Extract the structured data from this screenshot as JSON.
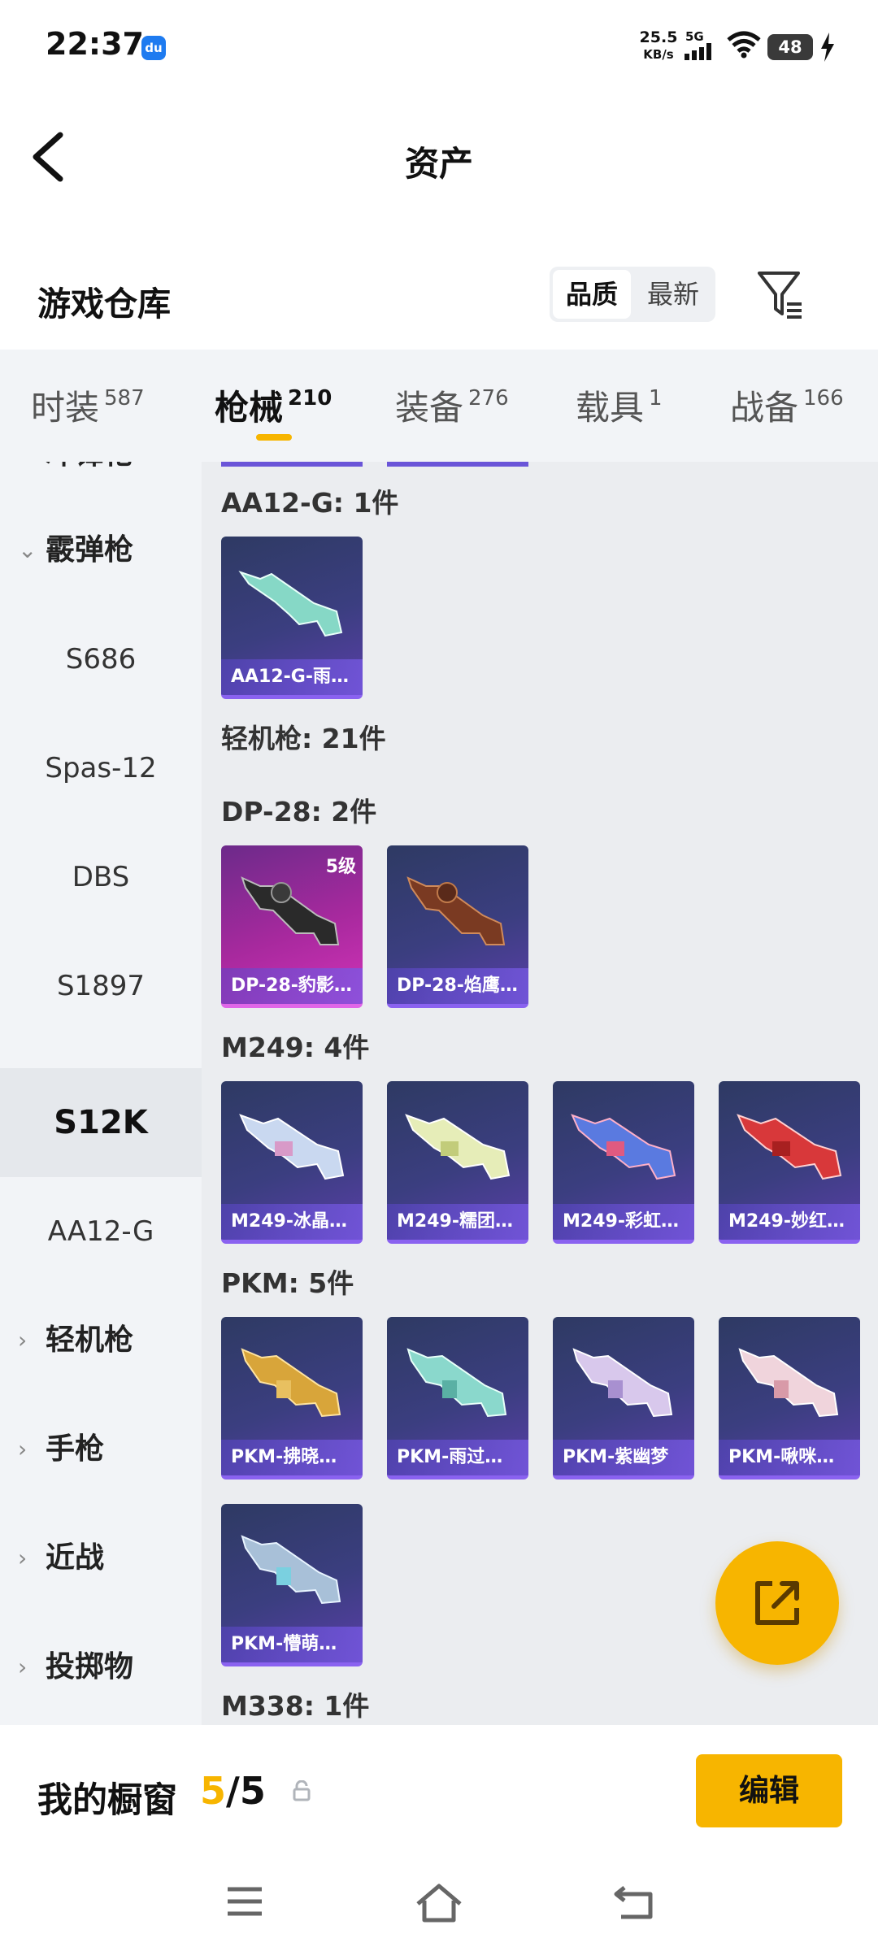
{
  "status_bar": {
    "time": "22:37",
    "app_badge": "du",
    "net_speed": "25.5",
    "net_unit": "KB/s",
    "network": "5G",
    "battery": "48"
  },
  "header": {
    "title": "资产"
  },
  "section": {
    "title": "游戏仓库",
    "sort_options": [
      "品质",
      "最新"
    ]
  },
  "tabs": [
    {
      "label": "时装",
      "count": "587"
    },
    {
      "label": "枪械",
      "count": "210"
    },
    {
      "label": "装备",
      "count": "276"
    },
    {
      "label": "载具",
      "count": "1"
    },
    {
      "label": "战备",
      "count": "166"
    }
  ],
  "sidebar": {
    "items": [
      {
        "label": "冲锋枪",
        "kind": "category"
      },
      {
        "label": "霰弹枪",
        "kind": "category-open"
      },
      {
        "label": "S686",
        "kind": "sub"
      },
      {
        "label": "Spas-12",
        "kind": "sub"
      },
      {
        "label": "DBS",
        "kind": "sub"
      },
      {
        "label": "S1897",
        "kind": "sub"
      },
      {
        "label": "S12K",
        "kind": "sub-selected"
      },
      {
        "label": "AA12-G",
        "kind": "sub"
      },
      {
        "label": "轻机枪",
        "kind": "category"
      },
      {
        "label": "手枪",
        "kind": "category"
      },
      {
        "label": "近战",
        "kind": "category"
      },
      {
        "label": "投掷物",
        "kind": "category"
      }
    ]
  },
  "content": {
    "labels": {
      "aa12": "AA12-G: 1件",
      "lmg": "轻机枪: 21件",
      "dp28": "DP-28: 2件",
      "m249": "M249: 4件",
      "pkm": "PKM: 5件",
      "m338": "M338: 1件"
    },
    "cards": {
      "aa12_0": "AA12-G-雨…",
      "dp28_0": "DP-28-豹影…",
      "dp28_0_badge": "5级",
      "dp28_1": "DP-28-焰鹰…",
      "m249_0": "M249-冰晶…",
      "m249_1": "M249-糯团…",
      "m249_2": "M249-彩虹…",
      "m249_3": "M249-妙红…",
      "pkm_0": "PKM-拂晓…",
      "pkm_1": "PKM-雨过…",
      "pkm_2": "PKM-紫幽梦",
      "pkm_3": "PKM-啾咪…",
      "pkm_4": "PKM-懵萌…"
    }
  },
  "bottom_bar": {
    "title": "我的橱窗",
    "current": "5",
    "total": "/5",
    "edit_label": "编辑"
  },
  "colors": {
    "accent": "#f7b500",
    "card_epic": "#3b3e80",
    "card_legendary": "#c32fae"
  },
  "icons": [
    "back-arrow-icon",
    "filter-icon",
    "share-icon",
    "lock-icon",
    "menu-icon",
    "home-icon",
    "back-icon"
  ]
}
